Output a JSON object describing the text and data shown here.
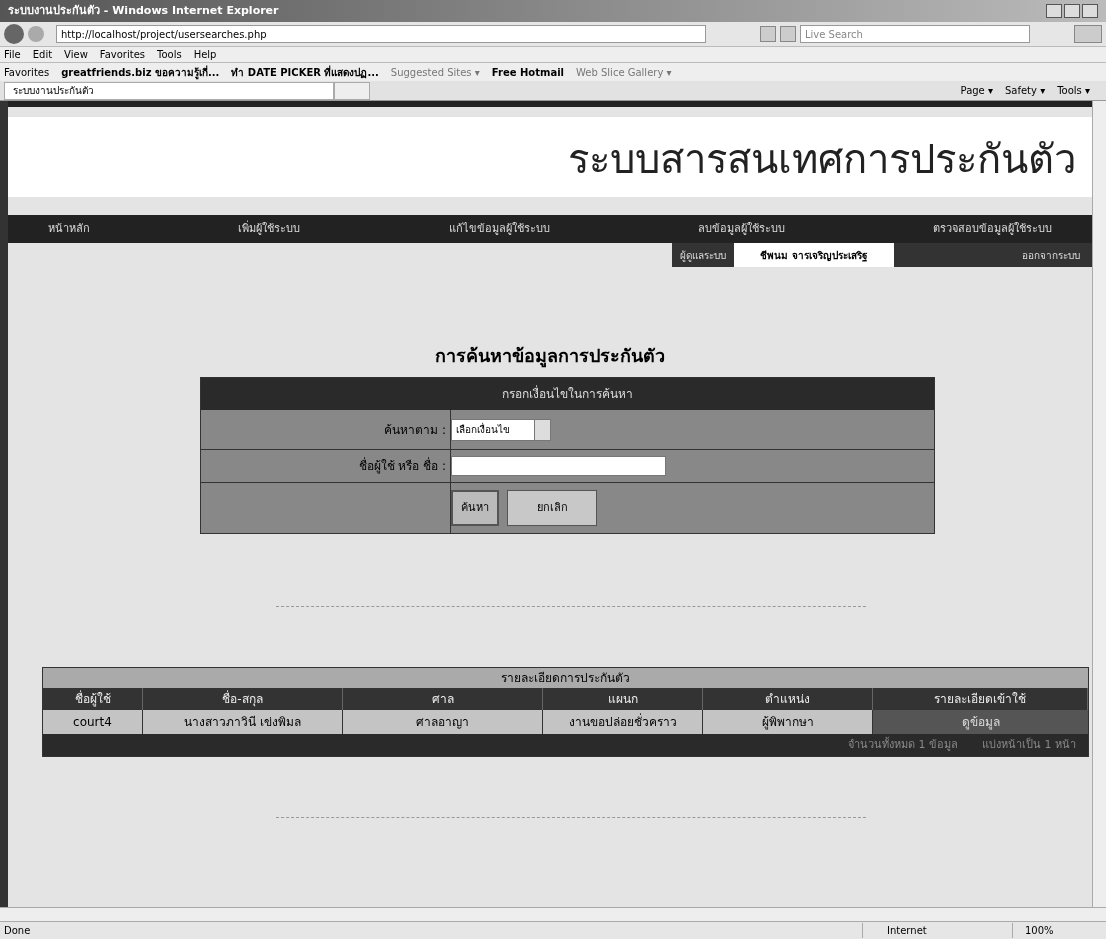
{
  "window": {
    "title": "ระบบงานประกันตัว - Windows Internet Explorer"
  },
  "address_bar": {
    "url": "http://localhost/project/usersearches.php",
    "search_placeholder": "Live Search"
  },
  "menu_bar": [
    "File",
    "Edit",
    "View",
    "Favorites",
    "Tools",
    "Help"
  ],
  "favorites_bar": {
    "label": "Favorites",
    "links": [
      "greatfriends.biz ขอความรู้เกี่...",
      "ทำ DATE PICKER ที่แสดงปฏ...",
      "Suggested Sites ▾",
      "Free Hotmail",
      "Web Slice Gallery ▾"
    ]
  },
  "tab": {
    "title": "ระบบงานประกันตัว"
  },
  "command_bar": [
    "Page ▾",
    "Safety ▾",
    "Tools ▾"
  ],
  "page": {
    "site_title": "ระบบสารสนเทศการประกันตัว",
    "nav": [
      {
        "label": "หน้าหลัก"
      },
      {
        "label": "เพิ่มผู้ใช้ระบบ"
      },
      {
        "label": "แก้ไขข้อมูลผู้ใช้ระบบ"
      },
      {
        "label": "ลบข้อมูลผู้ใช้ระบบ"
      },
      {
        "label": "ตรวจสอบข้อมูลผู้ใช้ระบบ"
      }
    ],
    "user_bar": {
      "role": "ผู้ดูแลระบบ",
      "name": "ชีพนม จารเจริญประเสริฐ",
      "logout": "ออกจากระบบ"
    },
    "search_heading": "การค้นหาข้อมูลการประกันตัว",
    "search_form": {
      "header": "กรอกเงื่อนไขในการค้นหา",
      "search_by_label": "ค้นหาตาม :",
      "search_by_value": "เลือกเงื่อนไข",
      "name_label": "ชื่อผู้ใช้ หรือ ชื่อ :",
      "buttons": [
        "ค้นหา",
        "ยกเลิก"
      ]
    },
    "results": {
      "title": "รายละเอียดการประกันตัว",
      "columns": [
        "ชื่อผู้ใช้",
        "ชื่อ-สกุล",
        "ศาล",
        "แผนก",
        "ตำแหน่ง",
        "รายละเอียดเข้าใช้"
      ],
      "rows": [
        [
          "court4",
          "นางสาวภาวินี เข่งพิมล",
          "ศาลอาญา",
          "งานขอปล่อยชั่วคราว",
          "ผู้พิพากษา",
          "ดูข้อมูล"
        ]
      ],
      "footer": [
        "จำนวนทั้งหมด 1 ข้อมูล",
        "แบ่งหน้าเป็น 1 หน้า"
      ]
    }
  },
  "status_bar": {
    "text": "Done",
    "zone": "Internet",
    "zoom": "100%"
  }
}
